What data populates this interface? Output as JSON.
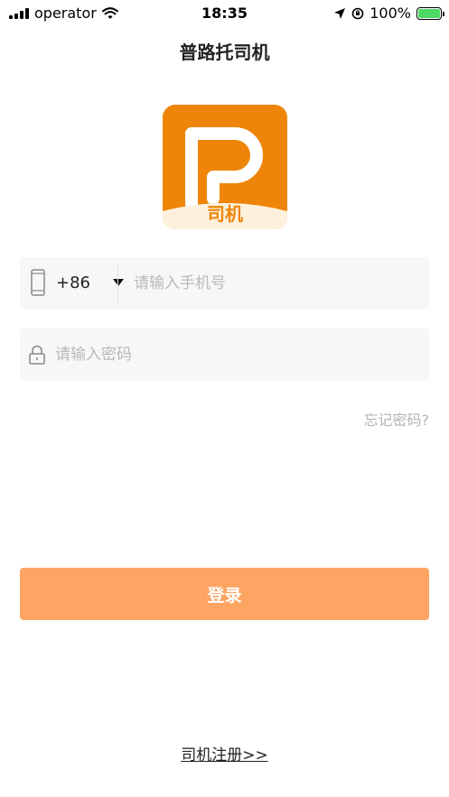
{
  "status_bar": {
    "carrier": "operator",
    "time": "18:35",
    "battery": "100%"
  },
  "title": "普路托司机",
  "logo": {
    "text": "司机",
    "icon": "p-letter-logo"
  },
  "phone": {
    "country_code": "+86",
    "placeholder": "请输入手机号",
    "value": ""
  },
  "password": {
    "placeholder": "请输入密码",
    "value": ""
  },
  "forgot_password": "忘记密码?",
  "login_button": "登录",
  "register_link": "司机注册>>",
  "colors": {
    "brand": "#ee8508",
    "login_button": "#fea563",
    "field_background": "#f7f7f7",
    "placeholder": "#b9b9b9"
  }
}
